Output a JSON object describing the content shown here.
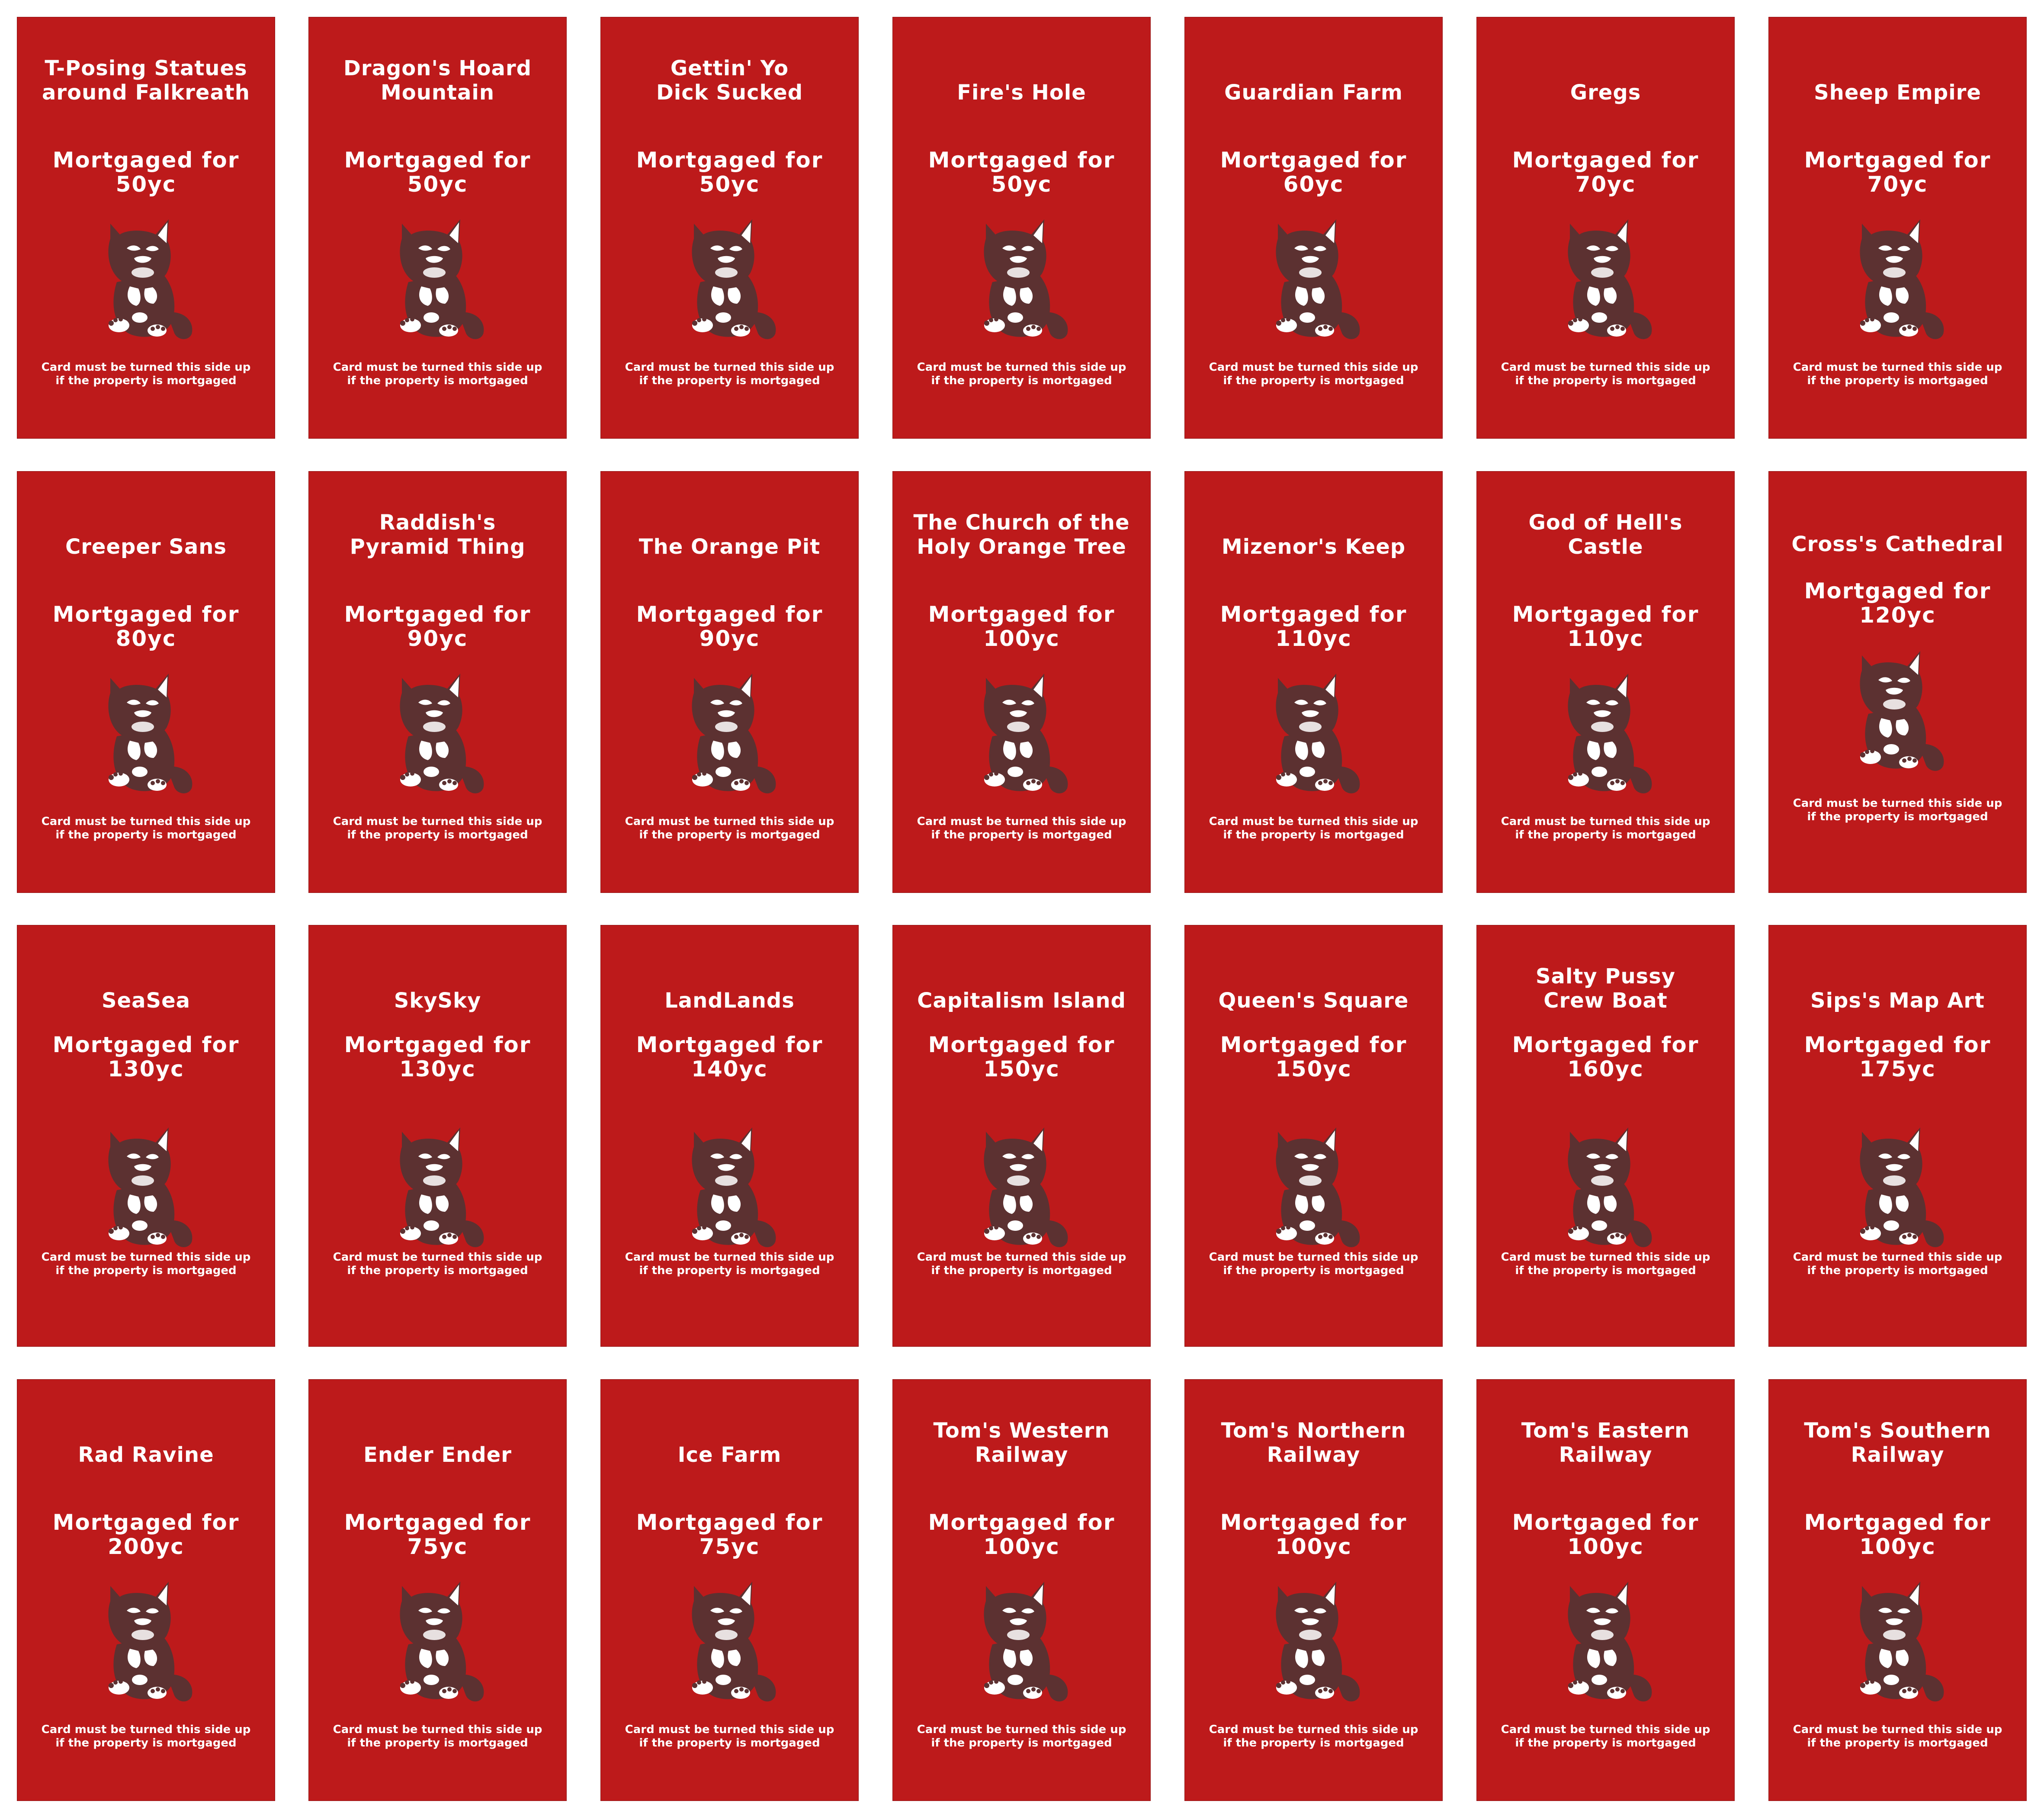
{
  "cards": [
    {
      "title": "T-Posing Statues\naround Falkreath",
      "price_label": "Mortgaged for",
      "price": "50yc"
    },
    {
      "title": "Dragon's Hoard\nMountain",
      "price_label": "Mortgaged for",
      "price": "50yc"
    },
    {
      "title": "Gettin' Yo\nDick Sucked",
      "price_label": "Mortgaged for",
      "price": "50yc"
    },
    {
      "title": "Fire's Hole",
      "price_label": "Mortgaged for",
      "price": "50yc"
    },
    {
      "title": "Guardian Farm",
      "price_label": "Mortgaged for",
      "price": "60yc"
    },
    {
      "title": "Gregs",
      "price_label": "Mortgaged for",
      "price": "70yc"
    },
    {
      "title": "Sheep Empire",
      "price_label": "Mortgaged for",
      "price": "70yc"
    },
    {
      "title": "Creeper Sans",
      "price_label": "Mortgaged for",
      "price": "80yc"
    },
    {
      "title": "Raddish's\nPyramid Thing",
      "price_label": "Mortgaged for",
      "price": "90yc"
    },
    {
      "title": "The Orange Pit",
      "price_label": "Mortgaged for",
      "price": "90yc"
    },
    {
      "title": "The Church of the\nHoly Orange Tree",
      "price_label": "Mortgaged for",
      "price": "100yc"
    },
    {
      "title": "Mizenor's Keep",
      "price_label": "Mortgaged for",
      "price": "110yc"
    },
    {
      "title": "God of Hell's\nCastle",
      "price_label": "Mortgaged for",
      "price": "110yc"
    },
    {
      "title": "Cross's Cathedral",
      "price_label": "Mortgaged for",
      "price": "120yc"
    },
    {
      "title": "SeaSea",
      "price_label": "Mortgaged for",
      "price": "130yc"
    },
    {
      "title": "SkySky",
      "price_label": "Mortgaged for",
      "price": "130yc"
    },
    {
      "title": "LandLands",
      "price_label": "Mortgaged for",
      "price": "140yc"
    },
    {
      "title": "Capitalism Island",
      "price_label": "Mortgaged for",
      "price": "150yc"
    },
    {
      "title": "Queen's Square",
      "price_label": "Mortgaged for",
      "price": "150yc"
    },
    {
      "title": "Salty Pussy\nCrew Boat",
      "price_label": "Mortgaged for",
      "price": "160yc"
    },
    {
      "title": "Sips's Map Art",
      "price_label": "Mortgaged for",
      "price": "175yc"
    },
    {
      "title": "Rad Ravine",
      "price_label": "Mortgaged for",
      "price": "200yc"
    },
    {
      "title": "Ender Ender",
      "price_label": "Mortgaged for",
      "price": "75yc"
    },
    {
      "title": "Ice Farm",
      "price_label": "Mortgaged for",
      "price": "75yc"
    },
    {
      "title": "Tom's Western\nRailway",
      "price_label": "Mortgaged for",
      "price": "100yc"
    },
    {
      "title": "Tom's Northern\nRailway",
      "price_label": "Mortgaged for",
      "price": "100yc"
    },
    {
      "title": "Tom's Eastern\nRailway",
      "price_label": "Mortgaged for",
      "price": "100yc"
    },
    {
      "title": "Tom's Southern\nRailway",
      "price_label": "Mortgaged for",
      "price": "100yc"
    }
  ],
  "card_note": "Card must be turned this side up\nif the property is mortgaged",
  "mascot_icon": "cat-mascot-icon",
  "colors": {
    "card_background": "#bd1a1b",
    "mascot": "#5c3131",
    "text": "#ffffff"
  }
}
